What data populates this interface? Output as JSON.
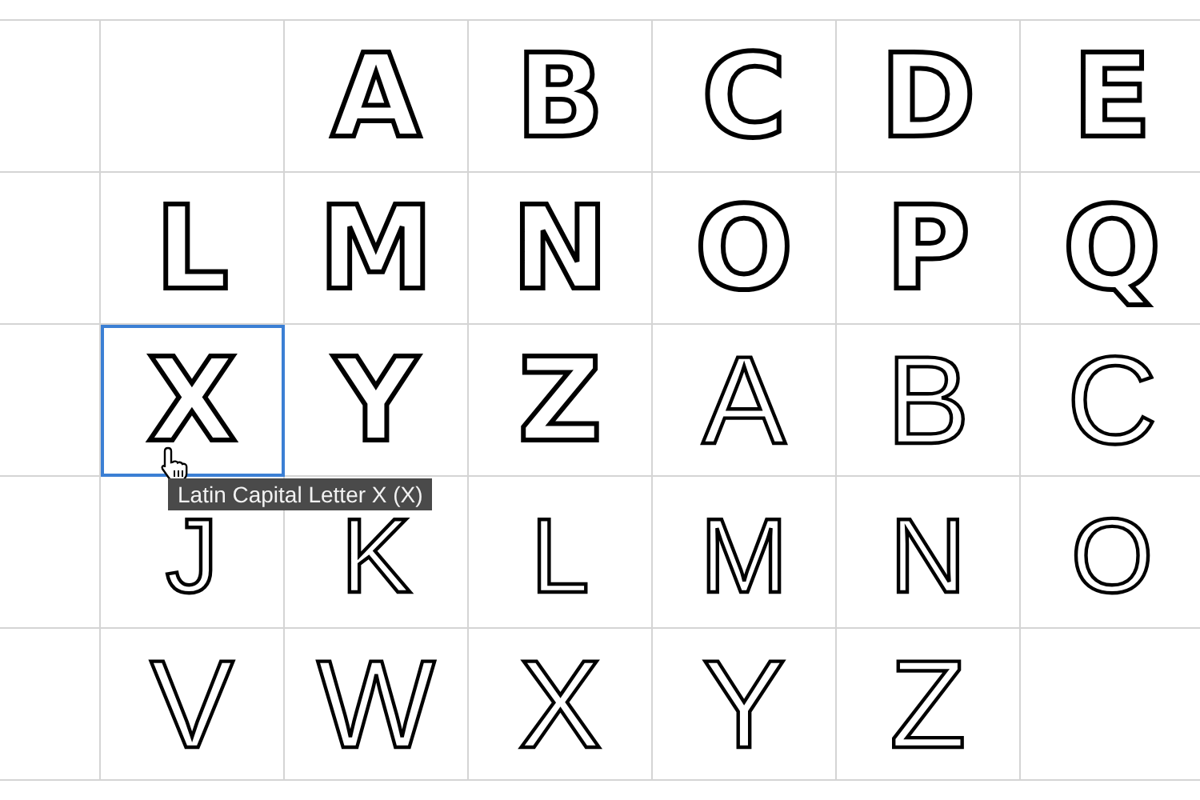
{
  "grid": {
    "rows": [
      {
        "kind": "bold",
        "cells": [
          {
            "selected": false
          },
          {
            "selected": false
          },
          {
            "glyph": "A",
            "selected": false
          },
          {
            "glyph": "B",
            "selected": false
          },
          {
            "glyph": "C",
            "selected": false
          },
          {
            "glyph": "D",
            "selected": false
          },
          {
            "glyph": "E",
            "selected": false
          }
        ]
      },
      {
        "kind": "bold",
        "cells": [
          {
            "selected": false
          },
          {
            "glyph": "L",
            "selected": false
          },
          {
            "glyph": "M",
            "selected": false
          },
          {
            "glyph": "N",
            "selected": false
          },
          {
            "glyph": "O",
            "selected": false
          },
          {
            "glyph": "P",
            "selected": false
          },
          {
            "glyph": "Q",
            "selected": false
          }
        ]
      },
      {
        "kind": "bold",
        "cells": [
          {
            "selected": false
          },
          {
            "glyph": "X",
            "selected": true
          },
          {
            "glyph": "Y",
            "selected": false
          },
          {
            "glyph": "Z",
            "selected": false
          },
          {
            "glyph": "A",
            "selected": false,
            "kind": "thin"
          },
          {
            "glyph": "B",
            "selected": false,
            "kind": "thin"
          },
          {
            "glyph": "C",
            "selected": false,
            "kind": "thin"
          }
        ]
      },
      {
        "kind": "thin",
        "cells": [
          {
            "selected": false
          },
          {
            "glyph": "J",
            "selected": false
          },
          {
            "glyph": "K",
            "selected": false
          },
          {
            "glyph": "L",
            "selected": false
          },
          {
            "glyph": "M",
            "selected": false
          },
          {
            "glyph": "N",
            "selected": false
          },
          {
            "glyph": "O",
            "selected": false
          }
        ]
      },
      {
        "kind": "thin",
        "cells": [
          {
            "selected": false
          },
          {
            "glyph": "V",
            "selected": false
          },
          {
            "glyph": "W",
            "selected": false
          },
          {
            "glyph": "X",
            "selected": false
          },
          {
            "glyph": "Y",
            "selected": false
          },
          {
            "glyph": "Z",
            "selected": false
          },
          {
            "selected": false
          }
        ]
      }
    ]
  },
  "tooltip": {
    "text": "Latin Capital Letter X (X)"
  }
}
